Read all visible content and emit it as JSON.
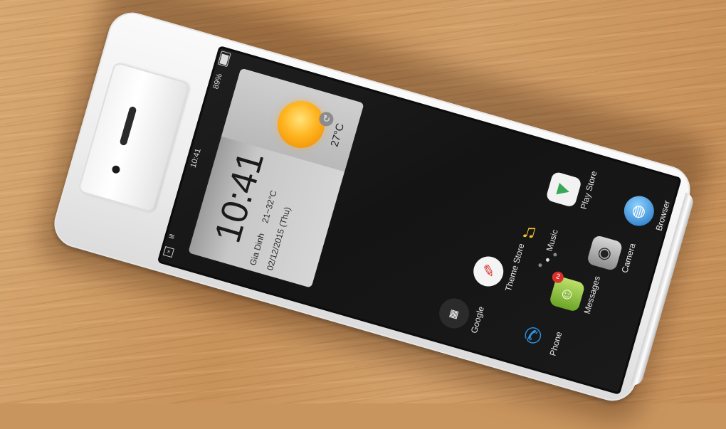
{
  "statusbar": {
    "battery": "89%",
    "time": "10:41"
  },
  "weather_widget": {
    "temperature": "27°C",
    "clock": "10:41",
    "location": "Gia Dinh",
    "range": "21~32°C",
    "date": "02/12/2015 (Thu)"
  },
  "apps": [
    {
      "label": "Play Store",
      "icon": "play-store-icon"
    },
    {
      "label": "Browser",
      "icon": "globe-icon"
    },
    {
      "label": "Music",
      "icon": "music-note-icon"
    },
    {
      "label": "Camera",
      "icon": "camera-icon"
    },
    {
      "label": "Theme Store",
      "icon": "palette-icon"
    },
    {
      "label": "Messages",
      "icon": "message-icon",
      "badge": "2"
    },
    {
      "label": "Google",
      "icon": "google-folder-icon"
    },
    {
      "label": "Phone",
      "icon": "phone-icon"
    }
  ],
  "colors": {
    "widget_bg": "#cfcfcf",
    "sun": "#ffb41f",
    "badge": "#d8312b"
  }
}
